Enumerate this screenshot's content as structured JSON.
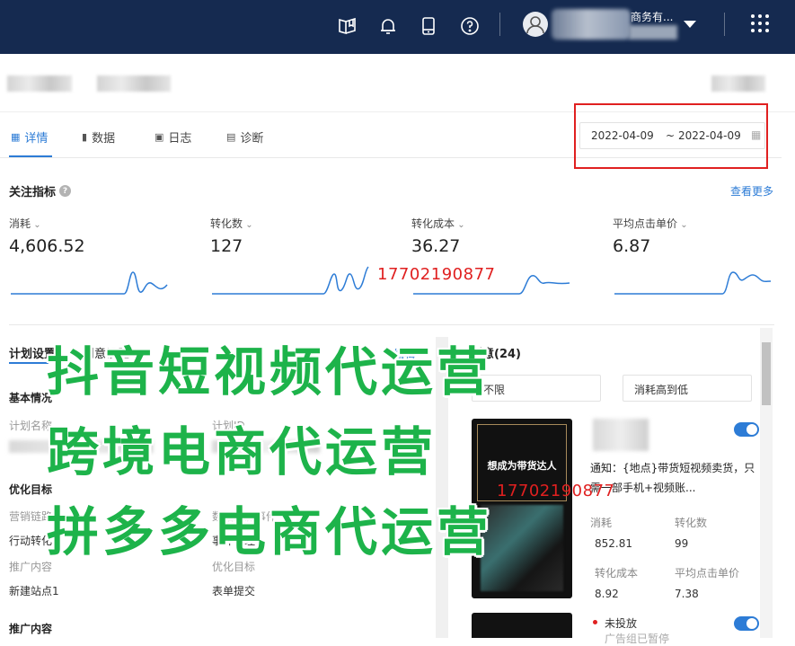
{
  "topbar": {
    "icons": [
      "book-icon",
      "bell-icon",
      "tablet-icon",
      "help-icon"
    ],
    "account_name_partial": "商务有..."
  },
  "tabs": [
    {
      "label": "详情",
      "icon": "chart-icon",
      "active": true
    },
    {
      "label": "数据",
      "icon": "bar-icon",
      "active": false
    },
    {
      "label": "日志",
      "icon": "log-icon",
      "active": false
    },
    {
      "label": "诊断",
      "icon": "diagnose-icon",
      "active": false
    }
  ],
  "date_range": {
    "start": "2022-04-09",
    "separator": "~",
    "end": "2022-04-09"
  },
  "metrics_section": {
    "title": "关注指标",
    "see_more": "查看更多",
    "items": [
      {
        "label": "消耗",
        "value": "4,606.52"
      },
      {
        "label": "转化数",
        "value": "127"
      },
      {
        "label": "转化成本",
        "value": "36.27"
      },
      {
        "label": "平均点击单价",
        "value": "6.87"
      }
    ]
  },
  "lower": {
    "tab_plan": "计划设置",
    "tab_creative": "创意设置",
    "edit": "编辑",
    "creative_count": "创意(24)",
    "basic_info": "基本情况",
    "plan_name_label": "计划名称",
    "plan_id_label": "计划ID",
    "optimize_target": "优化目标",
    "marketing_label": "营销链路",
    "marketing_value": "行动转化",
    "data_event_label": "数据监测事件",
    "data_event_value": "事件管理",
    "promo_content_label": "推广内容",
    "promo_content_value": "新建站点1",
    "opt_target_label": "优化目标",
    "opt_target_value": "表单提交",
    "promo_section": "推广内容"
  },
  "filters": {
    "status": "不限",
    "sort": "消耗高到低"
  },
  "creative": {
    "thumb_text": "想成为带货达人",
    "title": "通知：{地点}带货短视频卖货，只需一部手机+视频账...",
    "stats": [
      {
        "label": "消耗",
        "value": "852.81"
      },
      {
        "label": "转化数",
        "value": "99"
      },
      {
        "label": "转化成本",
        "value": "8.92"
      },
      {
        "label": "平均点击单价",
        "value": "7.38"
      }
    ],
    "status": "未投放",
    "status_sub": "广告组已暂停"
  },
  "overlays": {
    "phone": "17702190877",
    "watermark_lines": [
      "抖音短视频代运营",
      "跨境电商代运营",
      "拼多多电商代运营"
    ]
  },
  "colors": {
    "topbar": "#152a50",
    "accent": "#2d7cd6",
    "watermark": "#1db34a",
    "highlight": "#e02020"
  }
}
